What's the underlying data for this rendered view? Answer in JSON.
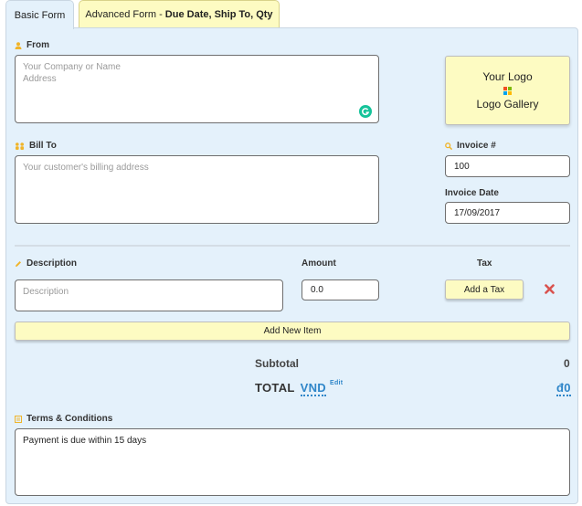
{
  "tabs": {
    "basic": "Basic Form",
    "advanced_prefix": "Advanced Form - ",
    "advanced_bold": "Due Date, Ship To, Qty"
  },
  "from": {
    "label": "From",
    "placeholder": "Your Company or Name\nAddress"
  },
  "logo": {
    "line1": "Your Logo",
    "line2": "Logo Gallery"
  },
  "bill_to": {
    "label": "Bill To",
    "placeholder": "Your customer's billing address"
  },
  "invoice_number": {
    "label": "Invoice #",
    "value": "100"
  },
  "invoice_date": {
    "label": "Invoice Date",
    "value": "17/09/2017"
  },
  "items": {
    "description_header": "Description",
    "amount_header": "Amount",
    "tax_header": "Tax",
    "description_placeholder": "Description",
    "amount_value": "0.0",
    "add_tax_label": "Add a Tax",
    "delete_icon": "×"
  },
  "add_new_item_label": "Add New Item",
  "totals": {
    "subtotal_label": "Subtotal",
    "subtotal_value": "0",
    "total_label": "TOTAL",
    "currency": "VND",
    "edit_label": "Edit",
    "total_value": "đ0"
  },
  "terms": {
    "label": "Terms & Conditions",
    "value": "Payment is due within 15 days"
  },
  "colors": {
    "panel_bg": "#e4f1fb",
    "yellow": "#fdfbc2",
    "icon_orange": "#f0b429",
    "link_blue": "#2f86c9",
    "delete_red": "#d9534f",
    "grammarly_green": "#15c39a"
  }
}
